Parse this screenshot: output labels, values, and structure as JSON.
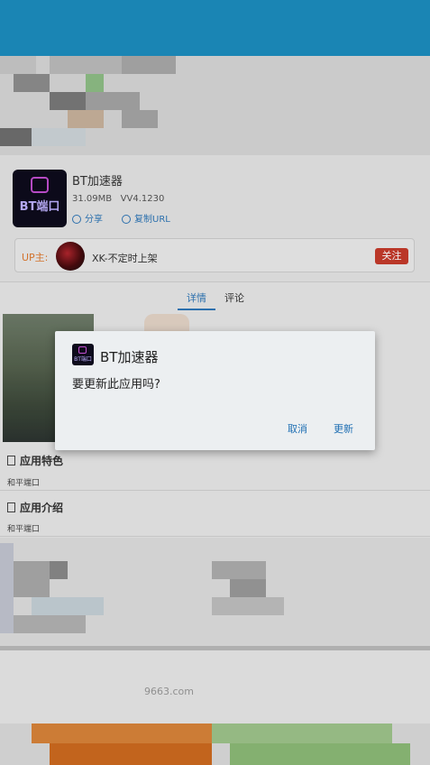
{
  "app": {
    "name": "BT加速器",
    "size": "31.09MB",
    "version": "VV4.1230",
    "icon_text": "BT端口",
    "actions": {
      "share": "分享",
      "copy_url": "复制URL"
    }
  },
  "uploader": {
    "label": "UP主:",
    "name": "XK-不定时上架",
    "follow": "关注"
  },
  "tabs": [
    {
      "label": "详情",
      "active": true
    },
    {
      "label": "评论",
      "active": false
    }
  ],
  "sections": [
    {
      "title": "应用特色",
      "text": "和平端口"
    },
    {
      "title": "应用介绍",
      "text": "和平端口"
    }
  ],
  "watermark": "9663.com",
  "dialog": {
    "title": "BT加速器",
    "message": "要更新此应用吗?",
    "cancel": "取消",
    "confirm": "更新"
  },
  "colors": {
    "accent": "#2f77b8",
    "header": "#1c8ec0",
    "follow": "#c63b2b",
    "up_label": "#e07a2f"
  }
}
